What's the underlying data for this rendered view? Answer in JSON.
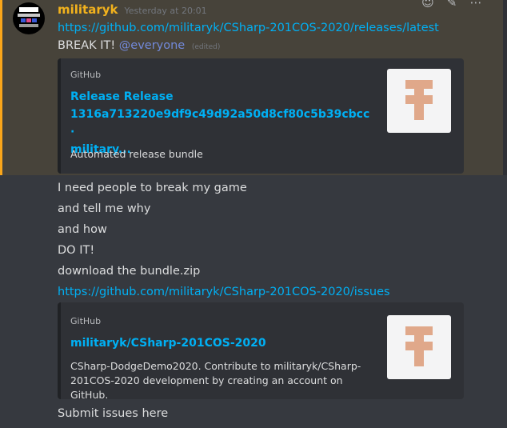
{
  "message": {
    "username": "militaryk",
    "timestamp": "Yesterday at 20:01",
    "link1": "https://github.com/militaryk/CSharp-201COS-2020/releases/latest",
    "break_text": "BREAK IT!",
    "mention": "@everyone",
    "edited": "(edited)",
    "embed1": {
      "provider": "GitHub",
      "title_line1": "Release Release",
      "title_line2": "1316a713220e9df9c49d92a50d8cf80c5b39cbcc ·",
      "title_line3": "military...",
      "description": "Automated release bundle"
    },
    "lines": [
      "I need people to break my game",
      "and tell me why",
      "and how",
      "DO IT!",
      "download the bundle.zip"
    ],
    "link2": "https://github.com/militaryk/CSharp-201COS-2020/issues",
    "embed2": {
      "provider": "GitHub",
      "title": "militaryk/CSharp-201COS-2020",
      "desc_line1": "CSharp-DodgeDemo2020. Contribute to militaryk/CSharp-",
      "desc_line2": "201COS-2020 development by creating an account on GitHub."
    },
    "final_line": "Submit issues here"
  },
  "colors": {
    "username": "#f2b21d",
    "link": "#00b0f4",
    "mention": "#7289da",
    "highlight_bar": "#faa61a",
    "thumb_glyph": "#e0a88a"
  },
  "icons": [
    "add-reaction-icon",
    "edit-icon",
    "more-icon"
  ]
}
